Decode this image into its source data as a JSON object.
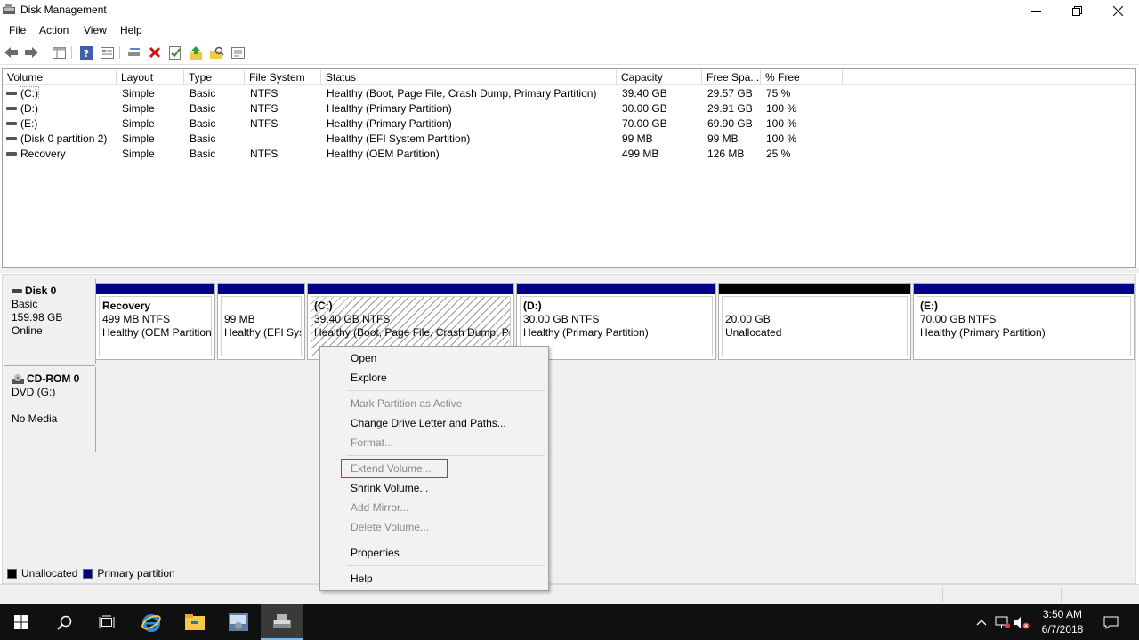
{
  "window": {
    "title": "Disk Management"
  },
  "menu": {
    "items": [
      "File",
      "Action",
      "View",
      "Help"
    ]
  },
  "toolbar": {
    "icons": [
      "back-icon",
      "forward-icon",
      "console-tree-icon",
      "help-icon",
      "properties-icon",
      "connect-icon",
      "delete-icon",
      "checklist-icon",
      "folder-up-icon",
      "folder-search-icon",
      "view-list-icon"
    ]
  },
  "volume_list": {
    "columns": [
      "Volume",
      "Layout",
      "Type",
      "File System",
      "Status",
      "Capacity",
      "Free Spa...",
      "% Free"
    ],
    "rows": [
      [
        "(C:)",
        "Simple",
        "Basic",
        "NTFS",
        "Healthy (Boot, Page File, Crash Dump, Primary Partition)",
        "39.40 GB",
        "29.57 GB",
        "75 %"
      ],
      [
        "(D:)",
        "Simple",
        "Basic",
        "NTFS",
        "Healthy (Primary Partition)",
        "30.00 GB",
        "29.91 GB",
        "100 %"
      ],
      [
        "(E:)",
        "Simple",
        "Basic",
        "NTFS",
        "Healthy (Primary Partition)",
        "70.00 GB",
        "69.90 GB",
        "100 %"
      ],
      [
        "(Disk 0 partition 2)",
        "Simple",
        "Basic",
        "",
        "Healthy (EFI System Partition)",
        "99 MB",
        "99 MB",
        "100 %"
      ],
      [
        "Recovery",
        "Simple",
        "Basic",
        "NTFS",
        "Healthy (OEM Partition)",
        "499 MB",
        "126 MB",
        "25 %"
      ]
    ]
  },
  "disks": {
    "disk0": {
      "name": "Disk 0",
      "type": "Basic",
      "size": "159.98 GB",
      "status": "Online",
      "partitions": [
        {
          "name": "Recovery",
          "size": "499 MB NTFS",
          "status": "Healthy (OEM Partition"
        },
        {
          "name": "",
          "size": "99 MB",
          "status": "Healthy (EFI Syst"
        },
        {
          "name": "(C:)",
          "size": "39.40 GB NTFS",
          "status": "Healthy (Boot, Page File, Crash Dump, Pri"
        },
        {
          "name": "(D:)",
          "size": "30.00 GB NTFS",
          "status": "Healthy (Primary Partition)"
        },
        {
          "name": "",
          "size": "20.00 GB",
          "status": "Unallocated"
        },
        {
          "name": "(E:)",
          "size": "70.00 GB NTFS",
          "status": "Healthy (Primary Partition)"
        }
      ]
    },
    "cdrom0": {
      "name": "CD-ROM 0",
      "drive": "DVD (G:)",
      "status": "No Media"
    }
  },
  "legend": {
    "unallocated": "Unallocated",
    "primary": "Primary partition",
    "unallocated_color": "#000000",
    "primary_color": "#00008b"
  },
  "context_menu": {
    "items": {
      "open": "Open",
      "explore": "Explore",
      "mark_active": "Mark Partition as Active",
      "change_letter": "Change Drive Letter and Paths...",
      "format": "Format...",
      "extend": "Extend Volume...",
      "shrink": "Shrink Volume...",
      "add_mirror": "Add Mirror...",
      "delete": "Delete Volume...",
      "properties": "Properties",
      "help": "Help"
    },
    "highlight_color": "#d32a2a"
  },
  "taskbar": {
    "apps": [
      "windows-start-icon",
      "search-icon",
      "task-view-icon",
      "internet-explorer-icon",
      "file-explorer-icon",
      "server-manager-icon",
      "disk-management-icon"
    ],
    "time": "3:50 AM",
    "date": "6/7/2018"
  }
}
